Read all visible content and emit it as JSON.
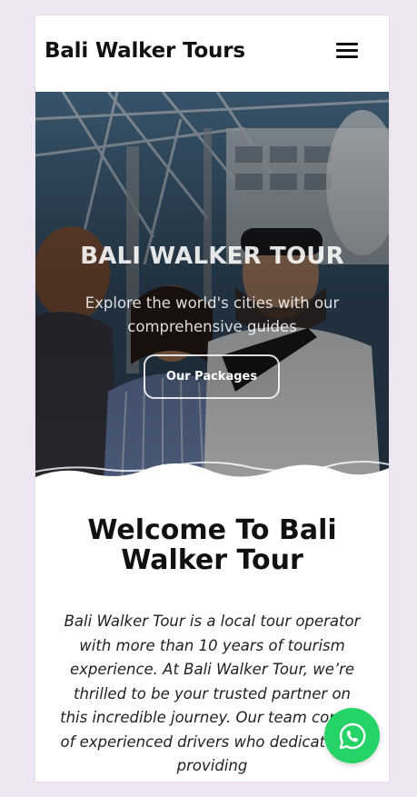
{
  "header": {
    "brand": "Bali Walker Tours",
    "menu_icon": "hamburger-menu-icon"
  },
  "hero": {
    "title": "BALI WALKER TOUR",
    "subtitle": "Explore the world's cities with our comprehensive guides",
    "cta_label": "Our Packages",
    "image_description": "group photo"
  },
  "main": {
    "welcome_title": "Welcome To Bali Walker Tour",
    "about_text": "Bali Walker Tour is a local tour operator with more than 10 years of tourism experience. At Bali Walker Tour, we’re thrilled to be your trusted partner on this incredible journey. Our team consist of experienced drivers who dedicated to providing"
  },
  "floating": {
    "whatsapp_icon": "whatsapp-icon"
  },
  "colors": {
    "page_background": "#efe6f3",
    "whatsapp_green": "#25d366",
    "text_dark": "#111111"
  }
}
